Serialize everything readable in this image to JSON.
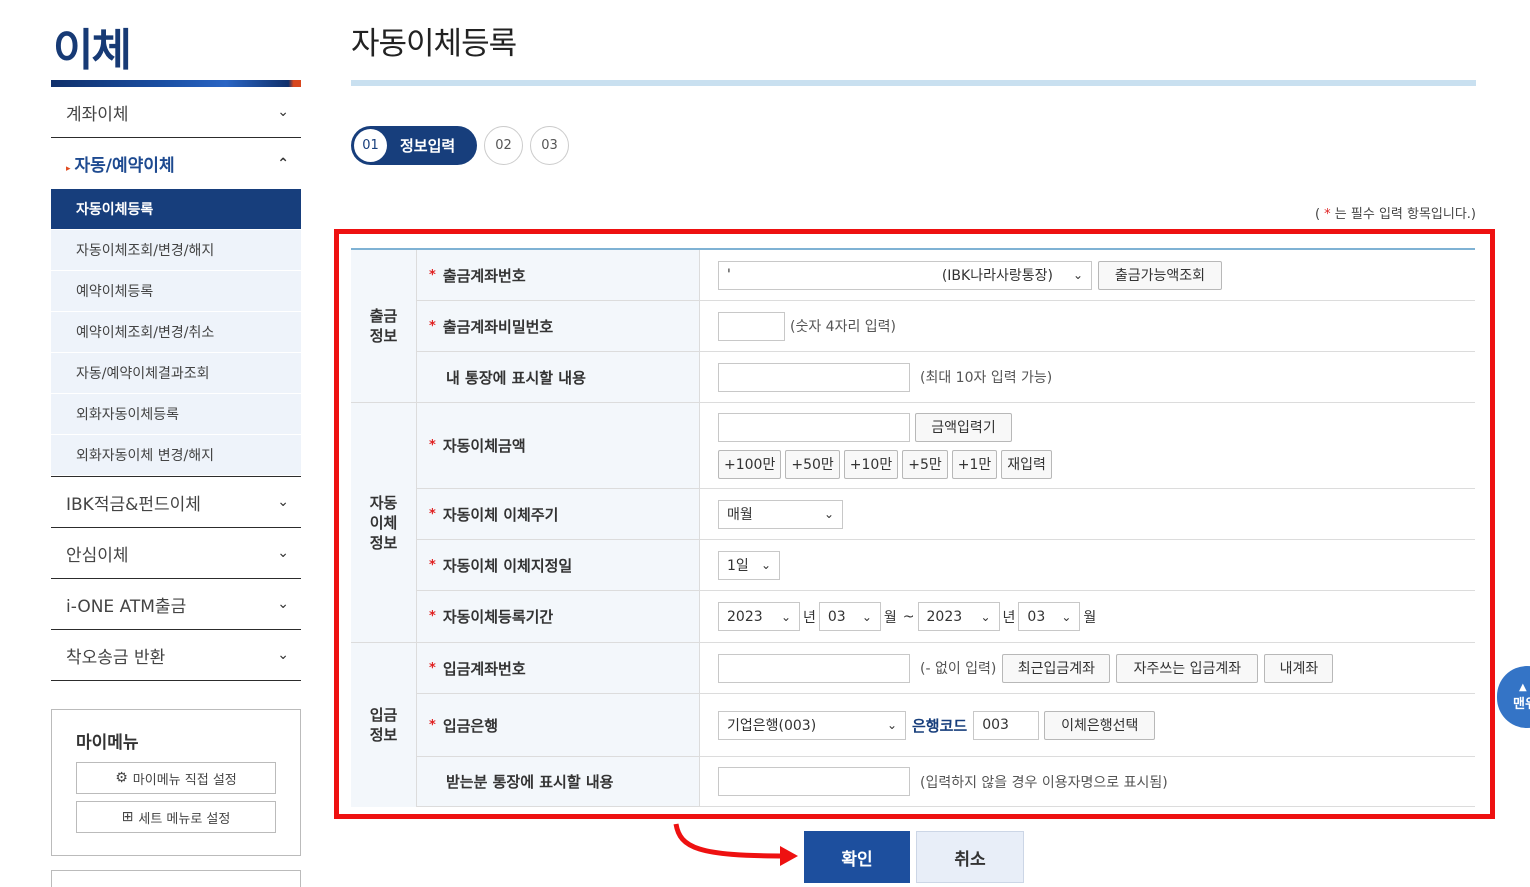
{
  "sidebar": {
    "section_title": "이체",
    "nav": [
      {
        "label": "계좌이체"
      },
      {
        "label": "자동/예약이체"
      },
      {
        "label": "IBK적금&펀드이체"
      },
      {
        "label": "안심이체"
      },
      {
        "label": "i-ONE ATM출금"
      },
      {
        "label": "착오송금 반환"
      }
    ],
    "subnav": [
      {
        "label": "자동이체등록"
      },
      {
        "label": "자동이체조회/변경/해지"
      },
      {
        "label": "예약이체등록"
      },
      {
        "label": "예약이체조회/변경/취소"
      },
      {
        "label": "자동/예약이체결과조회"
      },
      {
        "label": "외화자동이체등록"
      },
      {
        "label": "외화자동이체 변경/해지"
      }
    ],
    "mymenu": {
      "title": "마이메뉴",
      "direct_setting": "마이메뉴 직접 설정",
      "set_menu": "세트 메뉴로 설정"
    }
  },
  "main": {
    "page_title": "자동이체등록",
    "steps": {
      "step1_num": "01",
      "step1_label": "정보입력",
      "step2_num": "02",
      "step3_num": "03"
    },
    "required_note_prefix": "(",
    "required_note_star": "*",
    "required_note_text": "는 필수 입력 항목입니다.)"
  },
  "form": {
    "withdraw_group": "출금\n정보",
    "auto_group": "자동\n이체\n정보",
    "deposit_group": "입금\n정보",
    "withdraw_account_label": "출금계좌번호",
    "withdraw_account_value": "'",
    "withdraw_account_type": "(IBK나라사랑통장)",
    "balance_check_button": "출금가능액조회",
    "password_label": "출금계좌비밀번호",
    "password_hint": "(숫자 4자리 입력)",
    "memo_label": "내 통장에 표시할 내용",
    "memo_hint": "(최대 10자 입력 가능)",
    "amount_label": "자동이체금액",
    "amount_input_button": "금액입력기",
    "quick_amounts": [
      "+100만",
      "+50만",
      "+10만",
      "+5만",
      "+1만"
    ],
    "reset_button": "재입력",
    "cycle_label": "자동이체 이체주기",
    "cycle_value": "매월",
    "day_label": "자동이체 이체지정일",
    "day_value": "1일",
    "period_label": "자동이체등록기간",
    "start_year": "2023",
    "start_month": "03",
    "end_year": "2023",
    "end_month": "03",
    "year_unit": "년",
    "month_unit": "월",
    "tilde": "~",
    "deposit_account_label": "입금계좌번호",
    "deposit_account_hint": "(- 없이 입력)",
    "recent_account_button": "최근입금계좌",
    "frequent_account_button": "자주쓰는 입금계좌",
    "my_account_button": "내계좌",
    "deposit_bank_label": "입금은행",
    "bank_value": "기업은행(003)",
    "bank_code_label": "은행코드",
    "bank_code_value": "003",
    "bank_select_button": "이체은행선택",
    "receiver_memo_label": "받는분 통장에 표시할 내용",
    "receiver_memo_hint": "(입력하지 않을 경우 이용자명으로 표시됨)"
  },
  "actions": {
    "confirm": "확인",
    "cancel": "취소"
  },
  "floating": {
    "top_label": "맨위"
  },
  "colors": {
    "primary": "#173e7c",
    "highlight": "#ee1111",
    "required": "#e02020"
  }
}
